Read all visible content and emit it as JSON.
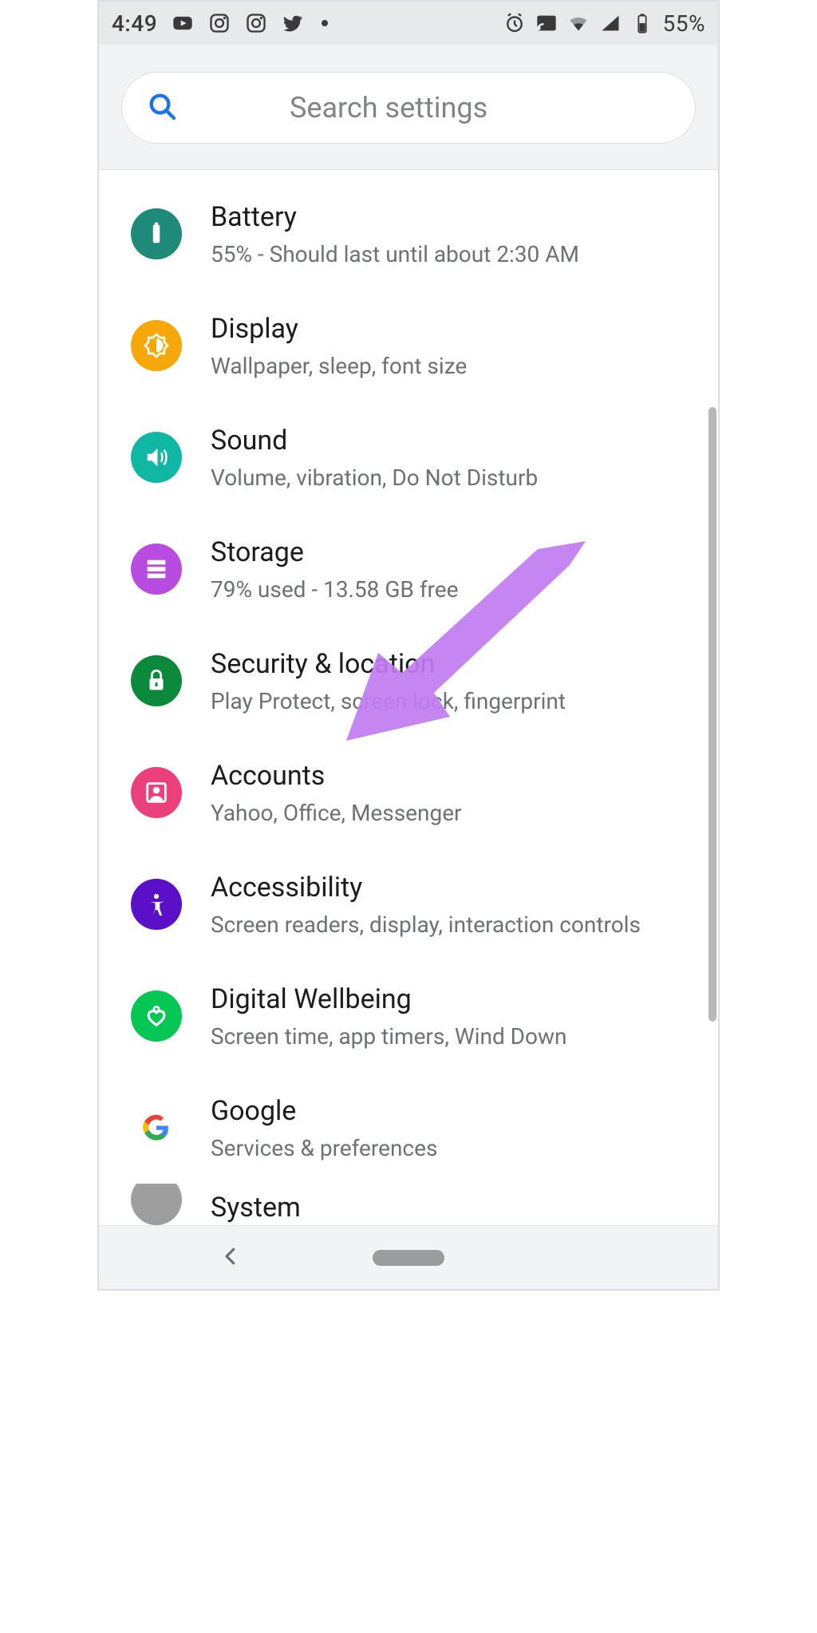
{
  "statusbar": {
    "time": "4:49",
    "battery_pct": "55%"
  },
  "search": {
    "placeholder": "Search settings"
  },
  "rows": [
    {
      "id": "battery",
      "title": "Battery",
      "subtitle": "55% - Should last until about 2:30 AM",
      "color": "bg-battery",
      "icon": "battery-icon"
    },
    {
      "id": "display",
      "title": "Display",
      "subtitle": "Wallpaper, sleep, font size",
      "color": "bg-display",
      "icon": "brightness-icon"
    },
    {
      "id": "sound",
      "title": "Sound",
      "subtitle": "Volume, vibration, Do Not Disturb",
      "color": "bg-sound",
      "icon": "volume-icon"
    },
    {
      "id": "storage",
      "title": "Storage",
      "subtitle": "79% used - 13.58 GB free",
      "color": "bg-storage",
      "icon": "storage-icon"
    },
    {
      "id": "security",
      "title": "Security & location",
      "subtitle": "Play Protect, screen lock, fingerprint",
      "color": "bg-security",
      "icon": "lock-icon"
    },
    {
      "id": "accounts",
      "title": "Accounts",
      "subtitle": "Yahoo, Office, Messenger",
      "color": "bg-accounts",
      "icon": "account-icon"
    },
    {
      "id": "accessibility",
      "title": "Accessibility",
      "subtitle": "Screen readers, display, interaction controls",
      "color": "bg-accessibility",
      "icon": "accessibility-icon"
    },
    {
      "id": "wellbeing",
      "title": "Digital Wellbeing",
      "subtitle": "Screen time, app timers, Wind Down",
      "color": "bg-wellbeing",
      "icon": "heart-icon"
    },
    {
      "id": "google",
      "title": "Google",
      "subtitle": "Services & preferences",
      "color": "bg-google",
      "icon": "google-icon"
    },
    {
      "id": "system",
      "title": "System",
      "subtitle": "",
      "color": "bg-system",
      "icon": "info-icon"
    }
  ]
}
